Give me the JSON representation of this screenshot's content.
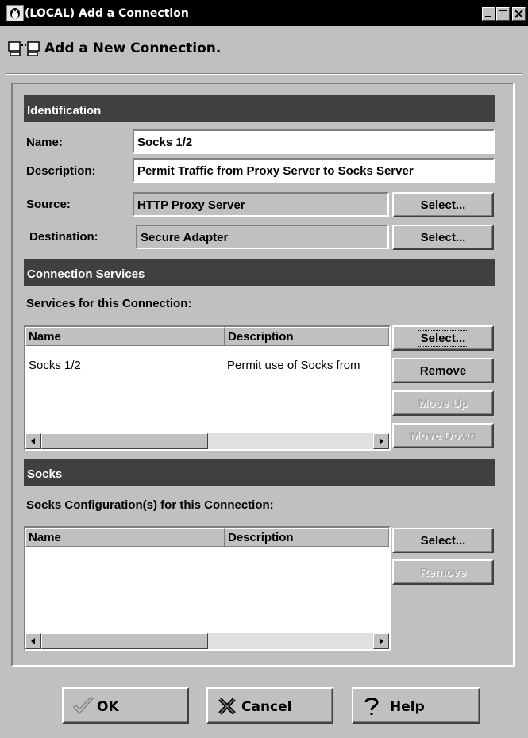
{
  "window": {
    "title": "(LOCAL) Add a Connection",
    "heading": "Add a New Connection."
  },
  "identification": {
    "section_title": "Identification",
    "name_label": "Name:",
    "name_value": "Socks 1/2",
    "description_label": "Description:",
    "description_value": "Permit Traffic from Proxy Server to Socks Server",
    "source_label": "Source:",
    "source_value": "HTTP Proxy Server",
    "destination_label": "Destination:",
    "destination_value": "Secure Adapter",
    "select_label": "Select..."
  },
  "services": {
    "section_title": "Connection Services",
    "list_label": "Services for this Connection:",
    "columns": [
      "Name",
      "Description"
    ],
    "rows": [
      {
        "name": "Socks 1/2",
        "description": "Permit use of Socks from"
      }
    ],
    "buttons": {
      "select": "Select...",
      "remove": "Remove",
      "move_up": "Move Up",
      "move_down": "Move Down"
    }
  },
  "socks": {
    "section_title": "Socks",
    "list_label": "Socks Configuration(s) for this Connection:",
    "columns": [
      "Name",
      "Description"
    ],
    "rows": [],
    "buttons": {
      "select": "Select...",
      "remove": "Remove"
    }
  },
  "footer": {
    "ok": "OK",
    "cancel": "Cancel",
    "help": "Help"
  },
  "icons": {
    "app": "tux-icon",
    "heading": "network-computers-icon",
    "ok": "checkmark-icon",
    "cancel": "x-icon",
    "help": "question-mark-icon"
  }
}
